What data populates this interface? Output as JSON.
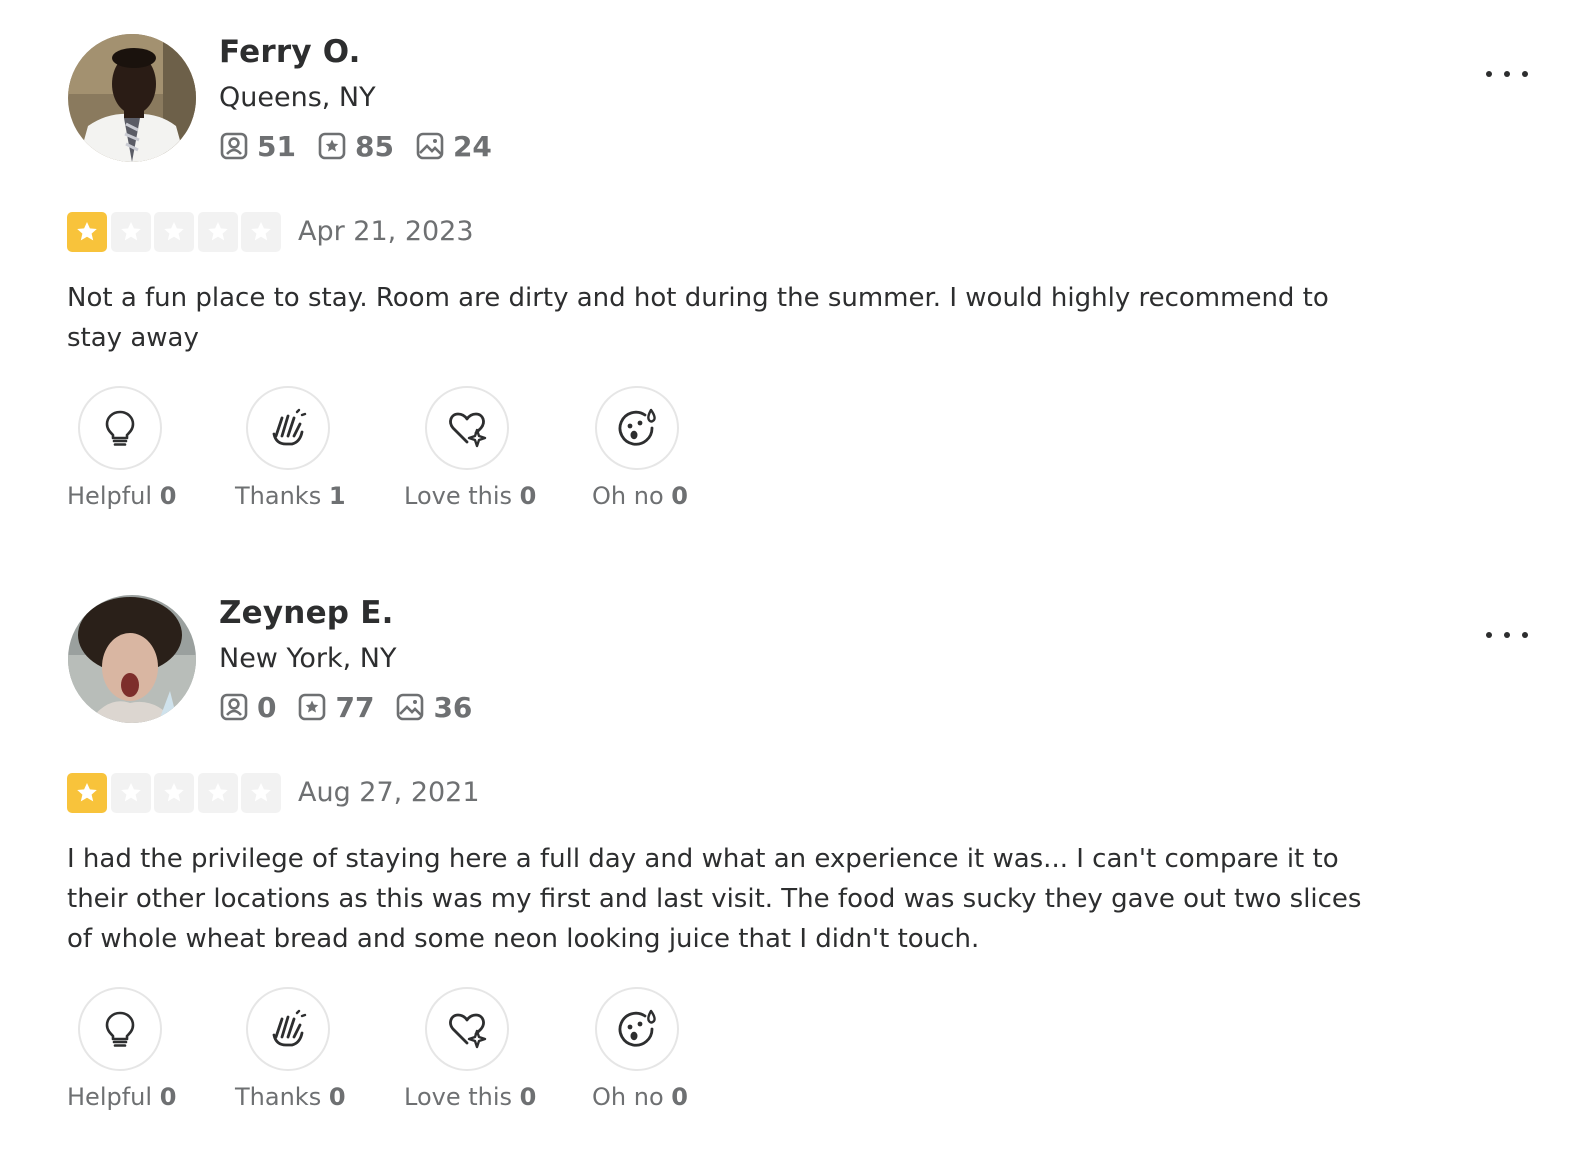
{
  "reviews": [
    {
      "user": {
        "name": "Ferry O.",
        "location": "Queens, NY",
        "friends": "51",
        "reviews": "85",
        "photos": "24"
      },
      "rating": 1,
      "date": "Apr 21, 2023",
      "text": "Not a fun place to stay. Room are dirty and hot during the summer. I would highly recommend to stay away",
      "reactions": [
        {
          "label": "Helpful",
          "count": "0",
          "icon": "lightbulb-icon"
        },
        {
          "label": "Thanks",
          "count": "1",
          "icon": "clapping-hands-icon"
        },
        {
          "label": "Love this",
          "count": "0",
          "icon": "heart-sparkle-icon"
        },
        {
          "label": "Oh no",
          "count": "0",
          "icon": "surprised-face-icon"
        }
      ]
    },
    {
      "user": {
        "name": "Zeynep E.",
        "location": "New York, NY",
        "friends": "0",
        "reviews": "77",
        "photos": "36"
      },
      "rating": 1,
      "date": "Aug 27, 2021",
      "text": "I had the privilege of staying here a full day and what an experience it was... I can't compare it to their other locations as this was my first and last visit. The food was sucky they gave out two slices of whole wheat bread and some neon looking juice that I didn't touch.",
      "reactions": [
        {
          "label": "Helpful",
          "count": "0",
          "icon": "lightbulb-icon"
        },
        {
          "label": "Thanks",
          "count": "0",
          "icon": "clapping-hands-icon"
        },
        {
          "label": "Love this",
          "count": "0",
          "icon": "heart-sparkle-icon"
        },
        {
          "label": "Oh no",
          "count": "0",
          "icon": "surprised-face-icon"
        }
      ]
    }
  ],
  "colors": {
    "star_active": "#f8c33b",
    "star_inactive": "#f2f2f2",
    "text": "#2d2e2f",
    "muted": "#6e7072"
  }
}
